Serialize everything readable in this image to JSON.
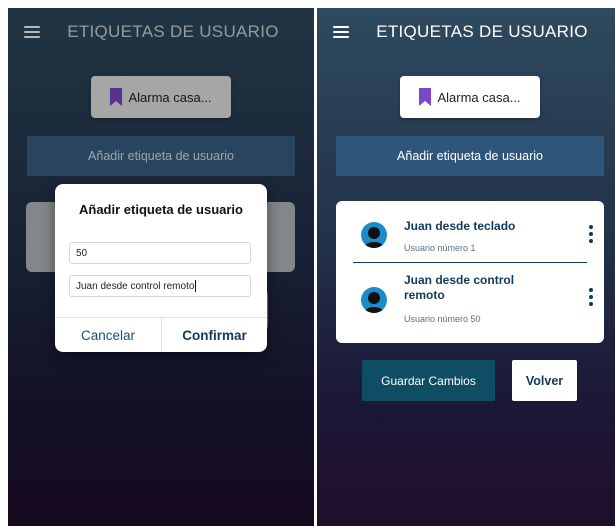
{
  "colors": {
    "accent_dark": "#0e4d63",
    "primary_text": "#123a5a",
    "add_button_bg": "#2f567a",
    "bookmark": "#7b46c9",
    "avatar": "#1e8ac9"
  },
  "left_screen": {
    "app_title": "ETIQUETAS DE USUARIO",
    "menu_icon": "hamburger-menu-icon",
    "chip": {
      "icon": "bookmark-icon",
      "label": "Alarma casa..."
    },
    "add_tag_button": "Añadir etiqueta de usuario",
    "dialog": {
      "title": "Añadir etiqueta de usuario",
      "user_number_value": "50",
      "user_name_value": "Juan desde control remoto",
      "cancel_label": "Cancelar",
      "confirm_label": "Confirmar"
    }
  },
  "right_screen": {
    "app_title": "ETIQUETAS DE USUARIO",
    "menu_icon": "hamburger-menu-icon",
    "chip": {
      "icon": "bookmark-icon",
      "label": "Alarma casa..."
    },
    "add_tag_button": "Añadir etiqueta de usuario",
    "users": [
      {
        "name": "Juan desde teclado",
        "subtitle": "Usuario número 1",
        "icon": "person-avatar-icon"
      },
      {
        "name": "Juan desde control remoto",
        "subtitle": "Usuario número 50",
        "icon": "person-avatar-icon"
      }
    ],
    "save_button": "Guardar Cambios",
    "back_button": "Volver"
  }
}
